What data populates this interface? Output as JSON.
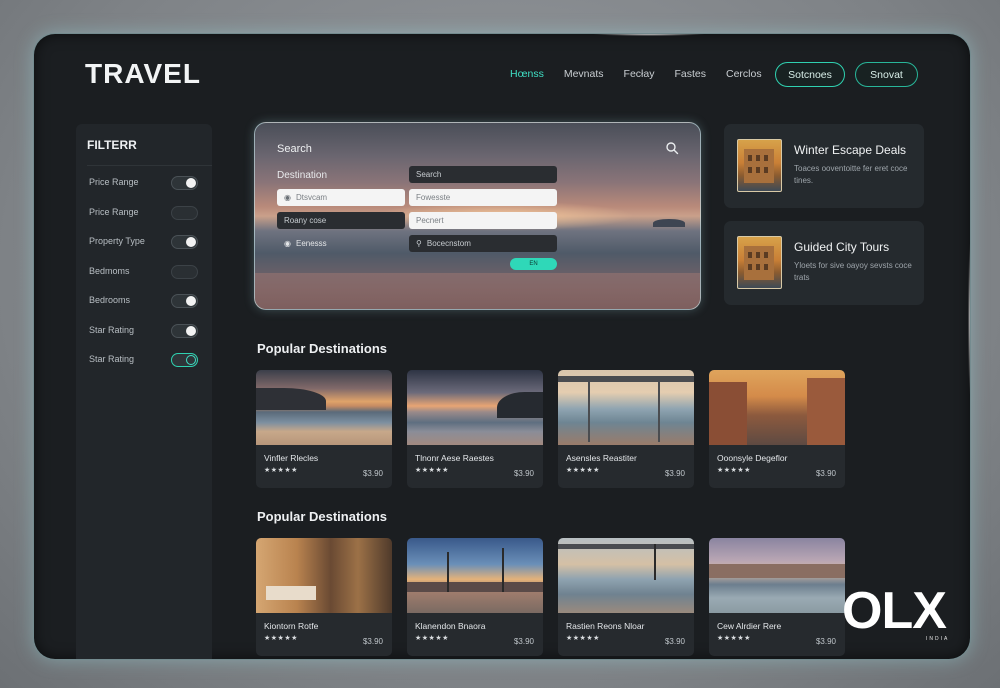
{
  "header": {
    "logo": "TRAVEL",
    "nav": [
      "Hœnss",
      "Mevnats",
      "Fecłay",
      "Fastes",
      "Cerclos"
    ],
    "buttons": [
      "Sotcnoes",
      "Snovat"
    ]
  },
  "sidebar": {
    "title": "FILTERR",
    "filters": [
      {
        "label": "Price Range",
        "state": "on"
      },
      {
        "label": "Price Range",
        "state": "off"
      },
      {
        "label": "Property Type",
        "state": "on"
      },
      {
        "label": "Bedmoms",
        "state": "off"
      },
      {
        "label": "Bedrooms",
        "state": "on"
      },
      {
        "label": "Star Rating",
        "state": "on"
      },
      {
        "label": "Star Rating",
        "state": "accent"
      }
    ]
  },
  "hero": {
    "title": "Search",
    "destination_label": "Destination",
    "search_label": "Search",
    "fields": [
      "Dtsvcam",
      "Fowesste",
      "Roany cose",
      "Pecnert",
      "Eenesss",
      "Bocecnstom"
    ],
    "go_label": "EN"
  },
  "deals": [
    {
      "title": "Winter Escape Deals",
      "desc": "Toaces ooventoitte fer eret coce tines."
    },
    {
      "title": "Guided City Tours",
      "desc": "Yloets for sive oayoy sevsts coce trats"
    }
  ],
  "sections": [
    {
      "title": "Popular Destinations",
      "cards": [
        {
          "title": "Vinfler Rlecles",
          "stars": "★★★★★",
          "price": "$3.90"
        },
        {
          "title": "Tlnonr Aese Raestes",
          "stars": "★★★★★",
          "price": "$3.90"
        },
        {
          "title": "Asensles Reastiter",
          "stars": "★★★★★",
          "price": "$3.90"
        },
        {
          "title": "Ooonsyle Degeflor",
          "stars": "★★★★★",
          "price": "$3.90"
        }
      ]
    },
    {
      "title": "Popular Destinations",
      "cards": [
        {
          "title": "Kiontorn Rotfe",
          "stars": "★★★★★",
          "price": "$3.90"
        },
        {
          "title": "Klanendon Bnaora",
          "stars": "★★★★★",
          "price": "$3.90"
        },
        {
          "title": "Rastien Reons Nloar",
          "stars": "★★★★★",
          "price": "$3.90"
        },
        {
          "title": "Cew Alrdier Rere",
          "stars": "★★★★★",
          "price": "$3.90"
        }
      ]
    }
  ],
  "watermark": {
    "brand": "OLX",
    "sub": "INDIA"
  },
  "colors": {
    "accent": "#2fd1b0",
    "panel": "#22262a",
    "frame": "#1b1e21"
  }
}
